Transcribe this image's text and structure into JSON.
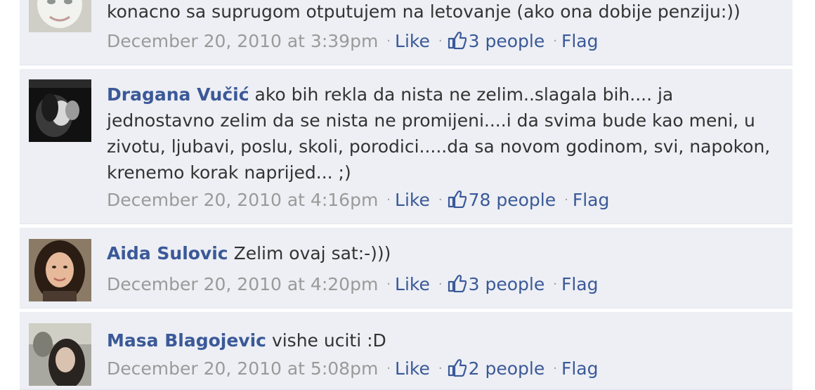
{
  "comments": [
    {
      "author": "",
      "text": "konacno sa suprugom otputujem na letovanje (ako ona dobije penziju:))",
      "date": "December 20, 2010 at 3:39pm",
      "like_label": "Like",
      "people_label": "3 people",
      "flag_label": "Flag"
    },
    {
      "author": "Dragana Vučić",
      "text": "ako bih rekla da nista ne zelim..slagala bih.... ja jednostavno zelim da se nista ne promijeni....i da svima bude kao meni, u zivotu, ljubavi, poslu, skoli, porodici.....da sa novom godinom, svi, napokon, krenemo korak naprijed... ;)",
      "date": "December 20, 2010 at 4:16pm",
      "like_label": "Like",
      "people_label": "78 people",
      "flag_label": "Flag"
    },
    {
      "author": "Aida Sulovic",
      "text": "Zelim ovaj sat:-)))",
      "date": "December 20, 2010 at 4:20pm",
      "like_label": "Like",
      "people_label": "3 people",
      "flag_label": "Flag"
    },
    {
      "author": "Masa Blagojevic",
      "text": "vishe uciti :D",
      "date": "December 20, 2010 at 5:08pm",
      "like_label": "Like",
      "people_label": "2 people",
      "flag_label": "Flag"
    }
  ],
  "separator": "·",
  "colors": {
    "link": "#3b5998",
    "meta": "#9a9a9a",
    "text": "#333333",
    "comment_bg": "#edeff4"
  }
}
